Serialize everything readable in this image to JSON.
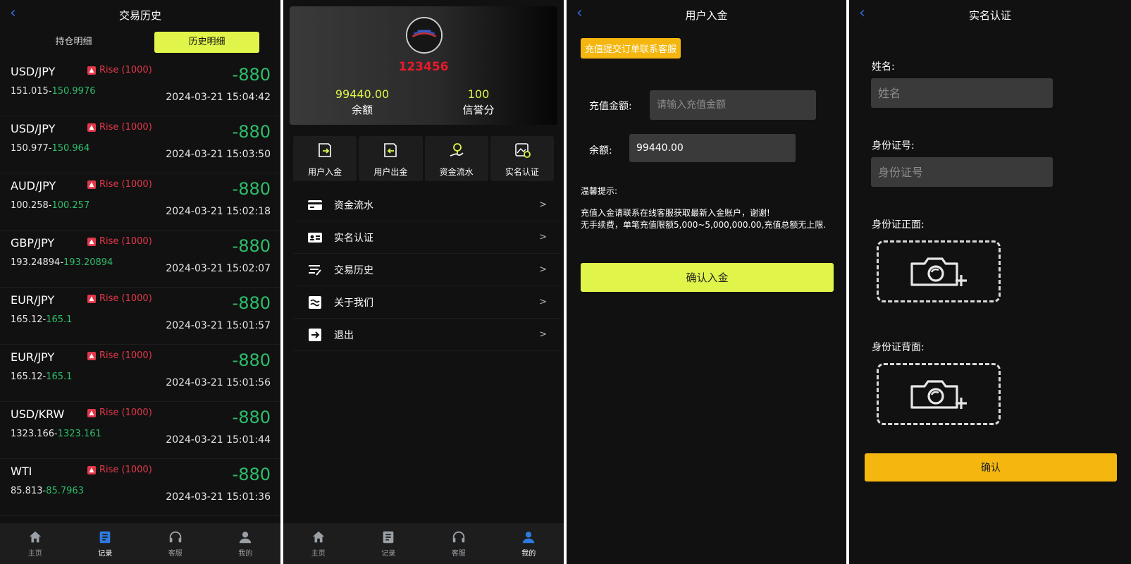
{
  "history": {
    "title": "交易历史",
    "back_glyph": "‹",
    "tabs": [
      {
        "label": "持仓明细",
        "active": false
      },
      {
        "label": "历史明细",
        "active": true
      }
    ],
    "trades": [
      {
        "pair": "USD/JPY",
        "direction": "Rise (1000)",
        "amount": "-880",
        "open": "151.015",
        "close": "150.9976",
        "time": "2024-03-21 15:04:42"
      },
      {
        "pair": "USD/JPY",
        "direction": "Rise (1000)",
        "amount": "-880",
        "open": "150.977",
        "close": "150.964",
        "time": "2024-03-21 15:03:50"
      },
      {
        "pair": "AUD/JPY",
        "direction": "Rise (1000)",
        "amount": "-880",
        "open": "100.258",
        "close": "100.257",
        "time": "2024-03-21 15:02:18"
      },
      {
        "pair": "GBP/JPY",
        "direction": "Rise (1000)",
        "amount": "-880",
        "open": "193.24894",
        "close": "193.20894",
        "time": "2024-03-21 15:02:07"
      },
      {
        "pair": "EUR/JPY",
        "direction": "Rise (1000)",
        "amount": "-880",
        "open": "165.12",
        "close": "165.1",
        "time": "2024-03-21 15:01:57"
      },
      {
        "pair": "EUR/JPY",
        "direction": "Rise (1000)",
        "amount": "-880",
        "open": "165.12",
        "close": "165.1",
        "time": "2024-03-21 15:01:56"
      },
      {
        "pair": "USD/KRW",
        "direction": "Rise (1000)",
        "amount": "-880",
        "open": "1323.166",
        "close": "1323.161",
        "time": "2024-03-21 15:01:44"
      },
      {
        "pair": "WTI",
        "direction": "Rise (1000)",
        "amount": "-880",
        "open": "85.813",
        "close": "85.7963",
        "time": "2024-03-21 15:01:36"
      }
    ],
    "tabbar": [
      {
        "label": "主页",
        "icon": "home-icon",
        "active": false
      },
      {
        "label": "记录",
        "icon": "records-icon",
        "active": true
      },
      {
        "label": "客服",
        "icon": "headset-icon",
        "active": false
      },
      {
        "label": "我的",
        "icon": "user-icon",
        "active": false
      }
    ]
  },
  "profile": {
    "uid": "123456",
    "balance_value": "99440.00",
    "balance_label": "余额",
    "credit_value": "100",
    "credit_label": "信誉分",
    "quick_actions": [
      {
        "label": "用户入金",
        "icon": "deposit-icon"
      },
      {
        "label": "用户出金",
        "icon": "withdraw-icon"
      },
      {
        "label": "资金流水",
        "icon": "fund-flow-icon"
      },
      {
        "label": "实名认证",
        "icon": "verify-icon"
      }
    ],
    "menu": [
      {
        "label": "资金流水",
        "icon": "card-icon"
      },
      {
        "label": "实名认证",
        "icon": "id-card-icon"
      },
      {
        "label": "交易历史",
        "icon": "history-icon"
      },
      {
        "label": "关于我们",
        "icon": "about-icon"
      },
      {
        "label": "退出",
        "icon": "logout-icon"
      }
    ],
    "arrow": ">",
    "tabbar": [
      {
        "label": "主页",
        "icon": "home-icon",
        "active": false
      },
      {
        "label": "记录",
        "icon": "records-icon",
        "active": false
      },
      {
        "label": "客服",
        "icon": "headset-icon",
        "active": false
      },
      {
        "label": "我的",
        "icon": "user-icon",
        "active": true
      }
    ]
  },
  "deposit": {
    "title": "用户入金",
    "tag": "充值提交订单联系客服",
    "amount_label": "充值金额:",
    "amount_placeholder": "请输入充值金额",
    "balance_label": "余额:",
    "balance_value": "99440.00",
    "note_title": "温馨提示:",
    "note_line1": "充值入金请联系在线客服获取最新入金账户，谢谢!",
    "note_line2": "无手续费，单笔充值限额5,000~5,000,000.00,充值总额无上限.",
    "confirm_label": "确认入金",
    "accent": "#e1f44a"
  },
  "verify": {
    "title": "实名认证",
    "name_label": "姓名:",
    "name_placeholder": "姓名",
    "id_label": "身份证号:",
    "id_placeholder": "身份证号",
    "front_label": "身份证正面:",
    "back_label": "身份证背面:",
    "confirm_label": "确认",
    "accent": "#f5b70f"
  }
}
